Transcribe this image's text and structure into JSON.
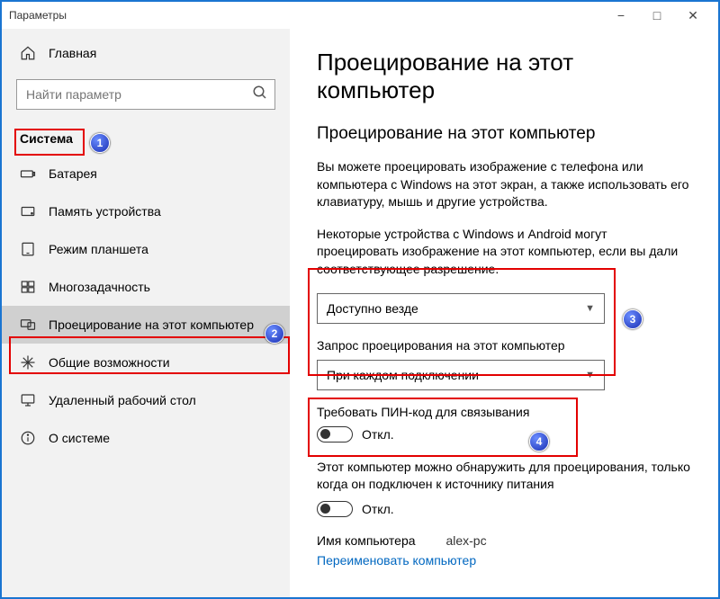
{
  "window": {
    "title": "Параметры"
  },
  "home_label": "Главная",
  "search": {
    "placeholder": "Найти параметр"
  },
  "section_title": "Система",
  "nav": [
    {
      "label": "Батарея"
    },
    {
      "label": "Память устройства"
    },
    {
      "label": "Режим планшета"
    },
    {
      "label": "Многозадачность"
    },
    {
      "label": "Проецирование на этот компьютер"
    },
    {
      "label": "Общие возможности"
    },
    {
      "label": "Удаленный рабочий стол"
    },
    {
      "label": "О системе"
    }
  ],
  "main": {
    "h1": "Проецирование на этот компьютер",
    "h2": "Проецирование на этот компьютер",
    "p1": "Вы можете проецировать изображение с телефона или компьютера с Windows на этот экран, а также использовать его клавиатуру, мышь и другие устройства.",
    "p2": "Некоторые устройства с Windows и Android могут проецировать изображение на этот компьютер, если вы дали соответствующее разрешение.",
    "dropdown1": "Доступно везде",
    "sublabel1": "Запрос проецирования на этот компьютер",
    "dropdown2": "При каждом подключении",
    "pin_label": "Требовать ПИН-код для связывания",
    "toggle1_state": "Откл.",
    "power_label": "Этот компьютер можно обнаружить для проецирования, только когда он подключен к источнику питания",
    "toggle2_state": "Откл.",
    "name_label": "Имя компьютера",
    "computer_name": "alex-pc",
    "rename_link": "Переименовать компьютер"
  },
  "annotations": {
    "b1": "1",
    "b2": "2",
    "b3": "3",
    "b4": "4"
  }
}
